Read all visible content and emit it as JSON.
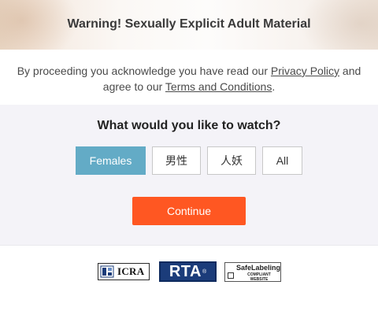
{
  "header": {
    "title": "Warning! Sexually Explicit Adult Material"
  },
  "disclaimer": {
    "line1_prefix": "By proceeding you acknowledge you have read our ",
    "privacy_link": "Privacy Policy",
    "line1_suffix": " and",
    "line2_prefix": "agree to our ",
    "terms_link": "Terms and Conditions",
    "line2_suffix": "."
  },
  "preferences": {
    "question": "What would you like to watch?",
    "options": [
      {
        "label": "Females",
        "selected": true
      },
      {
        "label": "男性",
        "selected": false
      },
      {
        "label": "人妖",
        "selected": false
      },
      {
        "label": "All",
        "selected": false
      }
    ],
    "continue_label": "Continue"
  },
  "badges": {
    "icra_text": "ICRA",
    "rta_text": "RTA",
    "rta_mark": "®",
    "safelabeling_title": "SafeLabeling",
    "safelabeling_sub1": "COMPLIANT",
    "safelabeling_sub2": "WEBSITE"
  },
  "colors": {
    "accent_selected": "#63abc6",
    "continue_button": "#ff5722",
    "rta_blue": "#1b3c7a"
  }
}
